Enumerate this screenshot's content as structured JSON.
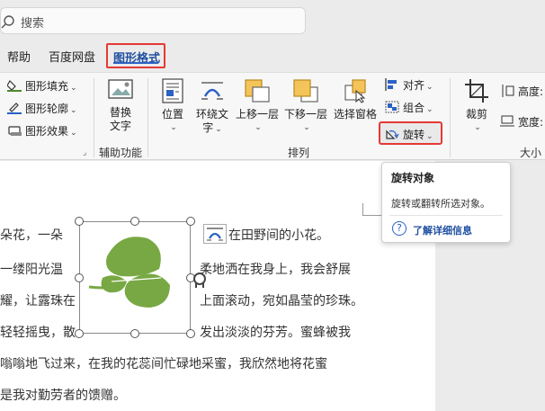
{
  "search": {
    "placeholder": "搜索"
  },
  "tabs": [
    {
      "label": "帮助"
    },
    {
      "label": "百度网盘"
    },
    {
      "label": "图形格式",
      "active": true
    }
  ],
  "ribbon": {
    "shape_styles": {
      "fill": "图形填充",
      "outline": "图形轮廓",
      "effects": "图形效果"
    },
    "accessibility": {
      "alt_text_line1": "替换",
      "alt_text_line2": "文字",
      "group_label": "辅助功能"
    },
    "arrange": {
      "position": "位置",
      "wrap_line1": "环绕文",
      "wrap_line2": "字",
      "bring_forward": "上移一层",
      "send_backward": "下移一层",
      "selection_pane": "选择窗格",
      "align": "对齐",
      "group": "组合",
      "rotate": "旋转",
      "group_label": "排列"
    },
    "size": {
      "crop": "裁剪",
      "height": "高度:",
      "width": "宽度:",
      "group_label": "大小"
    }
  },
  "document": {
    "lines": [
      "朵花，一朵",
      "一缕阳光温",
      "耀，让露珠在",
      "轻轻摇曳，散",
      "嗡嗡地飞过来，在我的花蕊间忙碌地采蜜，我欣然地将花蜜",
      "是我对勤劳者的馈赠。"
    ],
    "right_lines": [
      "在田野间的小花。",
      "柔地洒在我身上，我会舒展",
      "上面滚动，宛如晶莹的珍珠。",
      "发出淡淡的芬芳。蜜蜂被我"
    ]
  },
  "tooltip": {
    "title": "旋转对象",
    "description": "旋转或翻转所选对象。",
    "link": "了解详细信息"
  },
  "colors": {
    "accent_red": "#e53935",
    "active_tab_text": "#1f4fa0",
    "shape_green": "#78a844"
  }
}
